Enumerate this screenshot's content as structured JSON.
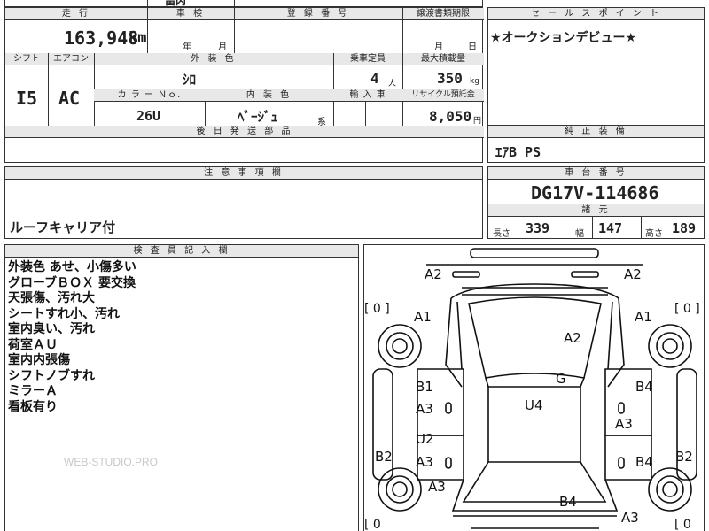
{
  "top_strip": {
    "text": "畐丙"
  },
  "mileage": {
    "header": "走 行",
    "value": "163,948",
    "unit": "km"
  },
  "inspection": {
    "header": "車 検",
    "year_label": "年",
    "month_label": "月"
  },
  "registration": {
    "header": "登 録 番 号",
    "value": ""
  },
  "transfer": {
    "header": "譲渡書類期限",
    "month_label": "月",
    "day_label": "日"
  },
  "shift": {
    "header": "シフト",
    "value": "I5"
  },
  "aircon": {
    "header": "エアコン",
    "value": "AC"
  },
  "exterior": {
    "header": "外 装 色",
    "value": "ｼﾛ"
  },
  "capacity": {
    "header": "乗車定員",
    "value": "4",
    "unit": "人"
  },
  "max_load": {
    "header": "最大積載量",
    "value": "350",
    "unit": "kg"
  },
  "color_no": {
    "header": "カ ラ ー Ｎｏ.",
    "value": "26U"
  },
  "interior": {
    "header": "内 装 色",
    "value": "ﾍﾞｰｼﾞｭ",
    "suffix": "系"
  },
  "import": {
    "header": "輸 入 車",
    "value": ""
  },
  "recycle": {
    "header": "リサイクル預託金",
    "value": "8,050",
    "unit": "円"
  },
  "later_parts": {
    "header": "後 日 発 送 部 品",
    "value": ""
  },
  "sales_point": {
    "header": "セ ー ル ス ポ イ ン ト",
    "value": "★オークションデビュー★"
  },
  "genuine": {
    "header": "純 正 装 備",
    "value": "ｴｱB PS"
  },
  "caution": {
    "header": "注 意 事 項 欄",
    "value": "ルーフキャリア付"
  },
  "chassis": {
    "header": "車 台 番 号",
    "value": "DG17V-114686"
  },
  "specs": {
    "header": "諸 元",
    "length_label": "長さ",
    "length": "339",
    "width_label": "幅",
    "width": "147",
    "height_label": "高さ",
    "height": "189"
  },
  "inspector": {
    "header": "検 査 員 記 入 欄",
    "notes": [
      "外装色 あせ、小傷多い",
      "グローブＢＯＸ 要交換",
      "天張傷、汚れ大",
      "シートすれ小、汚れ",
      "室内臭い、汚れ",
      "荷室ＡＵ",
      "室内内張傷",
      "シフトノブすれ",
      "ミラーＡ",
      "看板有り"
    ],
    "watermark": "WEB-STUDIO.PRO"
  },
  "diagram": {
    "tire_left_front": "[ 0 ]",
    "tire_right_front": "[ 0 ]",
    "tire_left_rear": "[ 0",
    "tire_right_rear": "[ 0",
    "marks": {
      "a2_top_left": "A2",
      "a2_top_right": "A2",
      "a1_left": "A1",
      "a1_right": "A1",
      "a2_hood": "A2",
      "g_mark": "G",
      "b1_left": "B1",
      "a3_left_door1": "A3",
      "b4_right_top": "B4",
      "u4_roof": "U4",
      "a3_right": "A3",
      "u2_left": "U2",
      "b2_left": "B2",
      "a3_left_door2": "A3",
      "b4_right_door": "B4",
      "b2_right": "B2",
      "a3_left_low": "A3",
      "b4_rear": "B4",
      "a3_right_low": "A3"
    }
  }
}
